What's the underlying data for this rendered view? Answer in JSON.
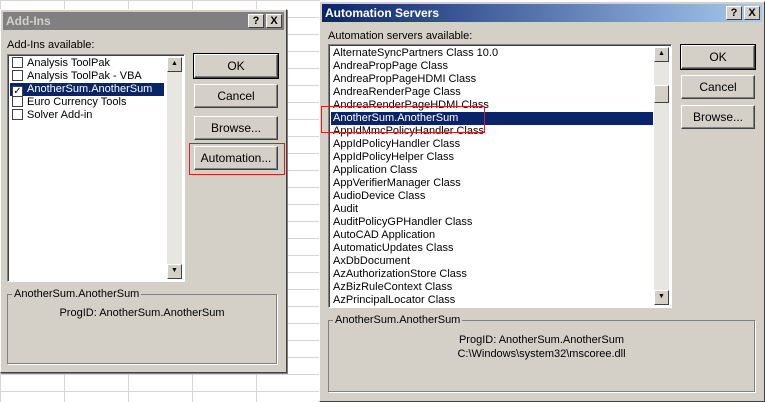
{
  "addins_dialog": {
    "title": "Add-Ins",
    "help_btn": "?",
    "close_btn": "X",
    "list_label": "Add-Ins available:",
    "items": [
      {
        "label": "Analysis ToolPak",
        "checked": false
      },
      {
        "label": "Analysis ToolPak - VBA",
        "checked": false
      },
      {
        "label": "AnotherSum.AnotherSum",
        "checked": true,
        "selected": true
      },
      {
        "label": "Euro Currency Tools",
        "checked": false
      },
      {
        "label": "Solver Add-in",
        "checked": false
      }
    ],
    "ok": "OK",
    "cancel": "Cancel",
    "browse": "Browse...",
    "automation": "Automation...",
    "group_title": "AnotherSum.AnotherSum",
    "progid": "ProgID: AnotherSum.AnotherSum"
  },
  "automation_dialog": {
    "title": "Automation Servers",
    "help_btn": "?",
    "close_btn": "X",
    "list_label": "Automation servers available:",
    "items": [
      "AlternateSyncPartners Class 10.0",
      "AndreaPropPage Class",
      "AndreaPropPageHDMI Class",
      "AndreaRenderPage Class",
      "AndreaRenderPageHDMI Class",
      "AnotherSum.AnotherSum",
      "AppIdMmcPolicyHandler Class",
      "AppIdPolicyHandler Class",
      "AppIdPolicyHelper Class",
      "Application Class",
      "AppVerifierManager Class",
      "AudioDevice Class",
      "Audit",
      "AuditPolicyGPHandler Class",
      "AutoCAD Application",
      "AutomaticUpdates Class",
      "AxDbDocument",
      "AzAuthorizationStore Class",
      "AzBizRuleContext Class",
      "AzPrincipalLocator Class"
    ],
    "selected_index": 5,
    "ok": "OK",
    "cancel": "Cancel",
    "browse": "Browse...",
    "group_title": "AnotherSum.AnotherSum",
    "progid": "ProgID: AnotherSum.AnotherSum",
    "path": "C:\\Windows\\system32\\mscoree.dll"
  },
  "colors": {
    "selection": "#0a246a",
    "highlight_box": "#d02020",
    "dialog_face": "#d4d0c8"
  }
}
